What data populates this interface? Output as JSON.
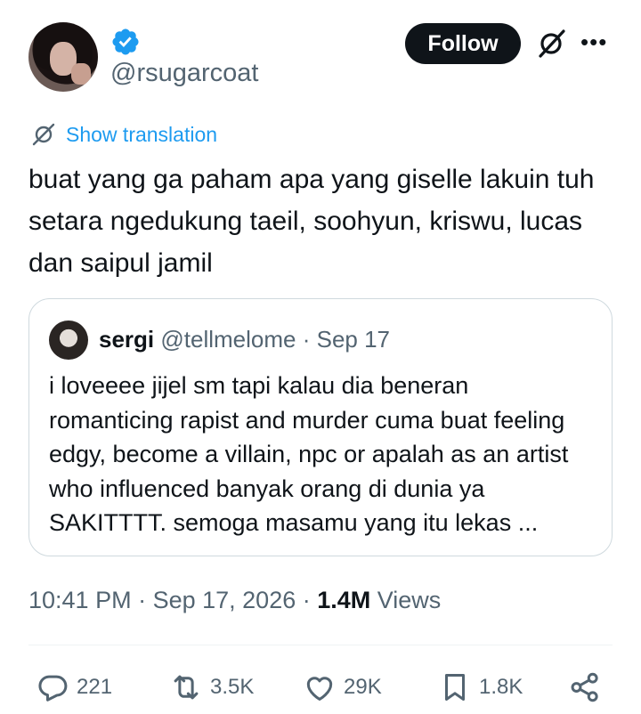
{
  "author": {
    "handle": "@rsugarcoat"
  },
  "header": {
    "follow_label": "Follow"
  },
  "translation": {
    "label": "Show translation"
  },
  "tweet": {
    "text": "buat yang ga paham apa yang giselle lakuin tuh setara ngedukung taeil, soohyun, kriswu, lucas dan saipul jamil"
  },
  "quoted": {
    "name": "sergi",
    "handle": "@tellmelome",
    "separator": " · ",
    "date": "Sep 17",
    "text": "i loveeee jijel sm tapi kalau dia beneran romanticing rapist and murder cuma buat feeling edgy, become a villain, npc or apalah as an artist who influenced banyak orang di dunia ya SAKITTTT. semoga masamu yang itu lekas ..."
  },
  "meta": {
    "time": "10:41 PM",
    "sep1": " · ",
    "date": "Sep 17, 2026",
    "sep2": " · ",
    "views_count": "1.4M",
    "views_label": " Views"
  },
  "actions": {
    "replies": "221",
    "reposts": "3.5K",
    "likes": "29K",
    "bookmarks": "1.8K"
  },
  "colors": {
    "accent": "#1d9bf0",
    "text": "#0f1419",
    "muted": "#536471"
  }
}
